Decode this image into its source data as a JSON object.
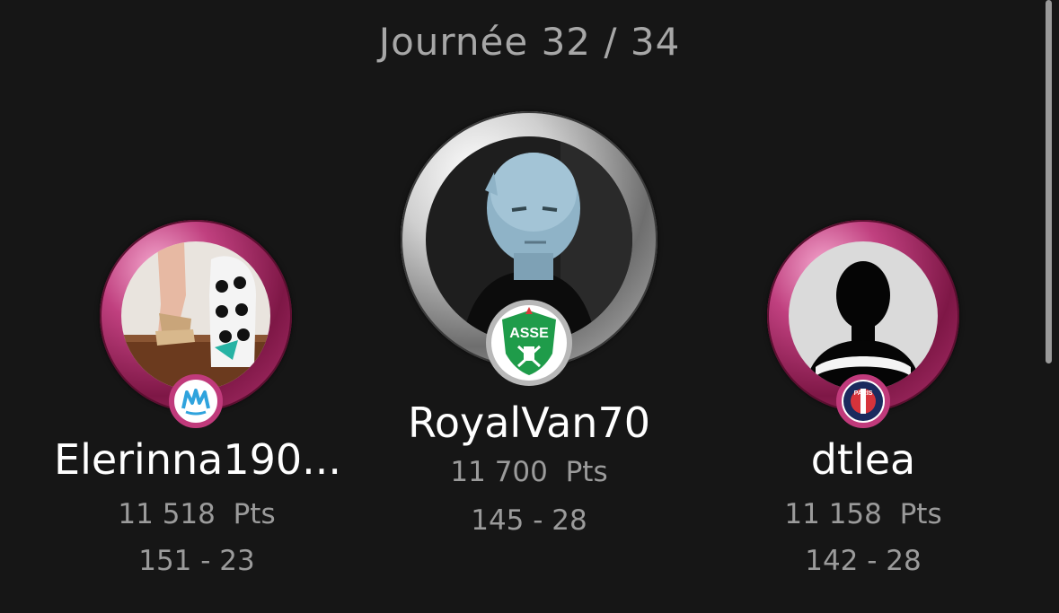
{
  "round": {
    "title": "Journée 32 / 34"
  },
  "colors": {
    "background": "#161616",
    "ring_pink": "#c03a7b",
    "ring_silver": "#b8b8b8",
    "text_primary": "#ffffff",
    "text_secondary": "#9b9b9b"
  },
  "podium": [
    {
      "rank_position": "left",
      "name": "Elerinna190...",
      "points": "11 518",
      "points_unit": "Pts",
      "record": "151 - 23",
      "ring": "pink",
      "club_badge_icon": "om-marseille-badge-icon",
      "badge_text": "M"
    },
    {
      "rank_position": "center",
      "name": "RoyalVan70",
      "points": "11 700",
      "points_unit": "Pts",
      "record": "145 - 28",
      "ring": "silver",
      "club_badge_icon": "asse-saint-etienne-badge-icon",
      "badge_text": "ASSE"
    },
    {
      "rank_position": "right",
      "name": "dtlea",
      "points": "11 158",
      "points_unit": "Pts",
      "record": "142 - 28",
      "ring": "pink",
      "club_badge_icon": "psg-paris-badge-icon",
      "badge_text": "PARIS"
    }
  ]
}
